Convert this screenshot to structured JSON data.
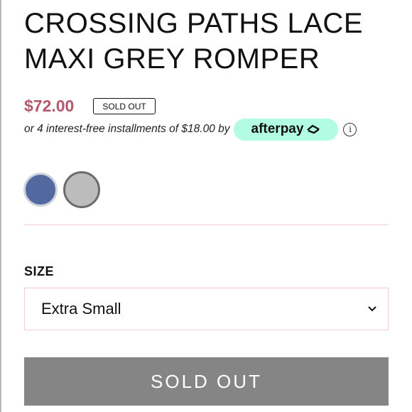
{
  "product": {
    "title": "CROSSING PATHS LACE MAXI GREY ROMPER",
    "price": "$72.00",
    "status_badge": "SOLD OUT"
  },
  "afterpay": {
    "installments_text": "or 4 interest-free installments of $18.00 by",
    "brand": "afterpay",
    "info_icon": "info-circle-icon"
  },
  "swatches": [
    {
      "name": "blue",
      "color": "#52699f"
    },
    {
      "name": "grey",
      "color": "#bcbcbc"
    }
  ],
  "size": {
    "label": "SIZE",
    "selected": "Extra Small"
  },
  "button": {
    "label": "SOLD OUT"
  },
  "colors": {
    "price": "#b3596c",
    "afterpay_pill": "#b2fce4",
    "button_bg": "#858585",
    "divider": "#f2cdd6"
  }
}
